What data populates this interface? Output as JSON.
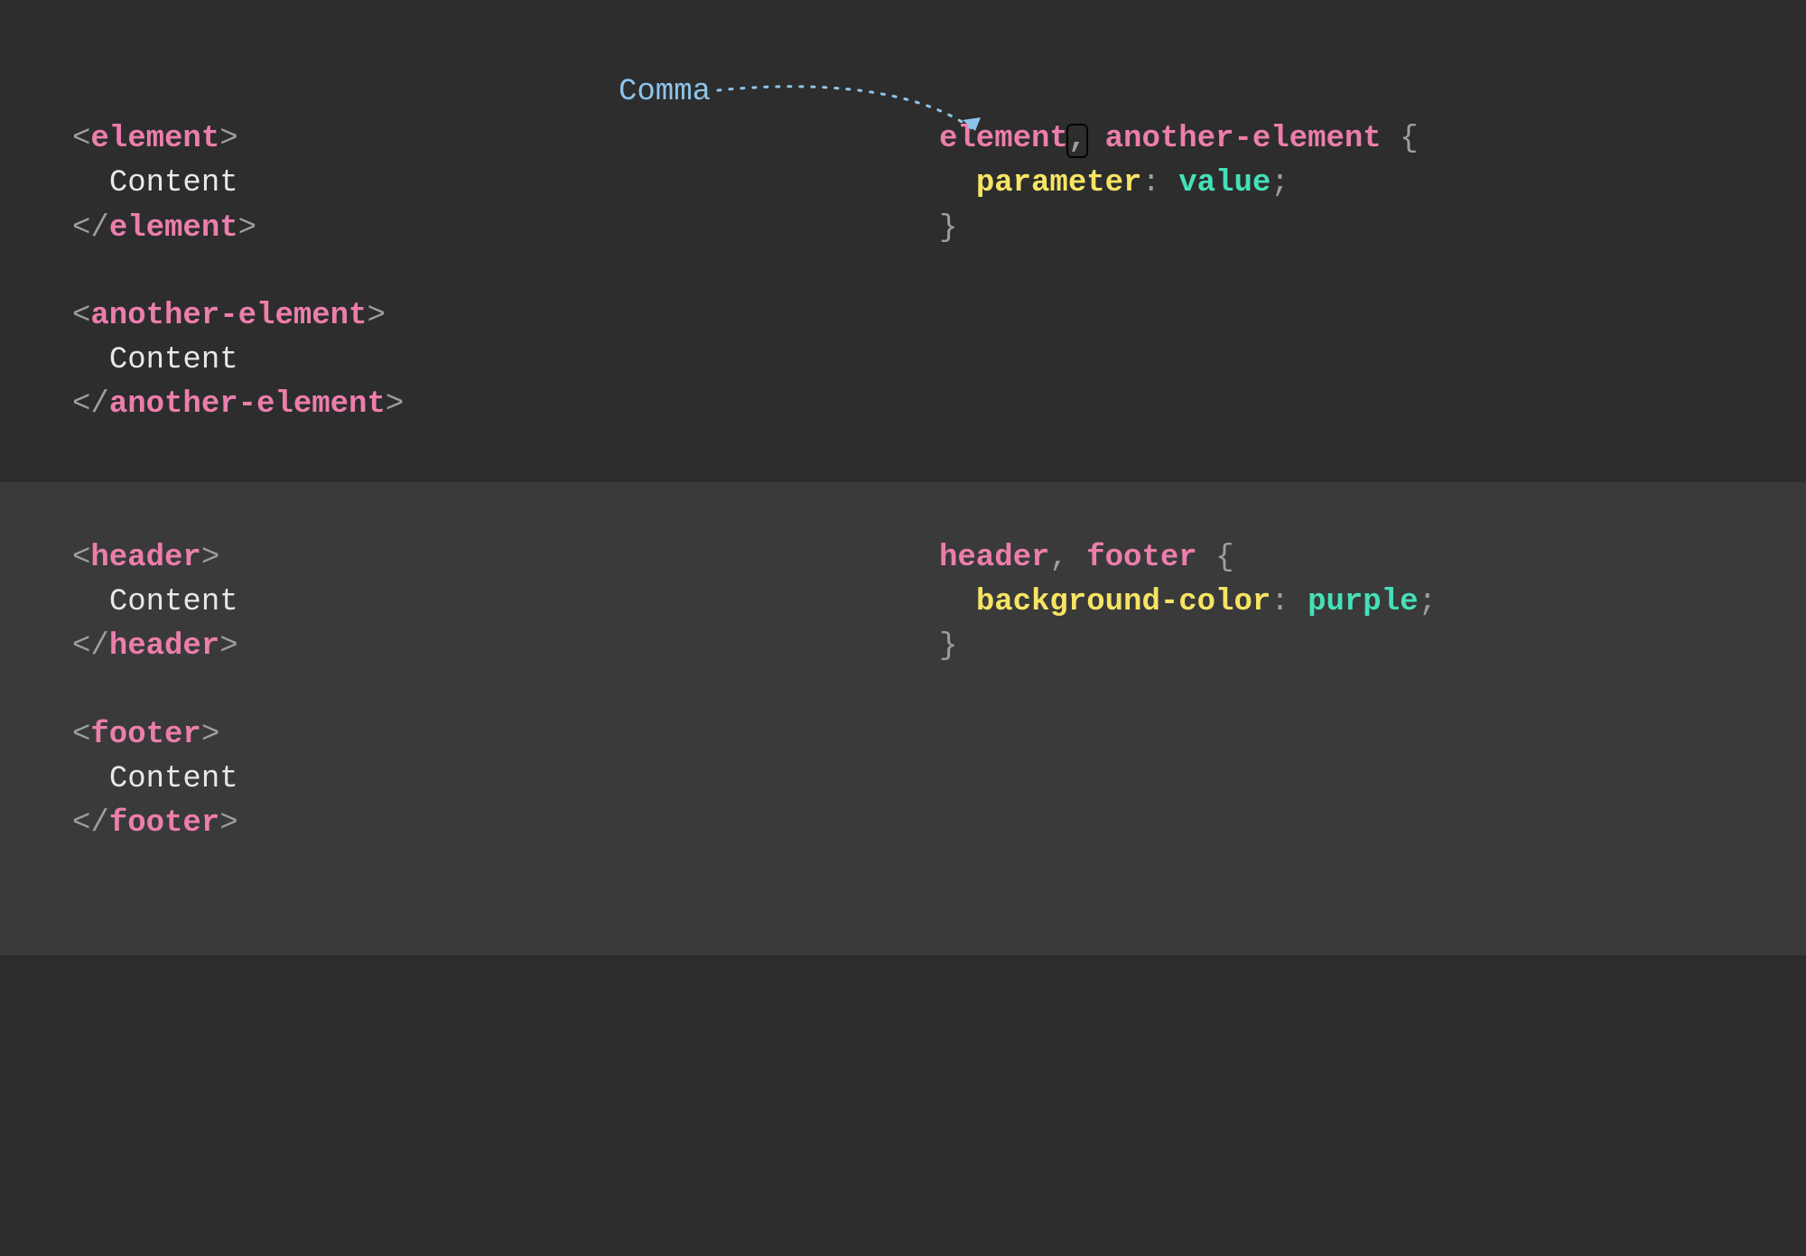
{
  "annotation": {
    "label": "Comma"
  },
  "top": {
    "html": {
      "block1": {
        "tag": "element",
        "content": "Content"
      },
      "block2": {
        "tag": "another-element",
        "content": "Content"
      }
    },
    "css": {
      "sel1": "element",
      "sep": ",",
      "sel2": "another-element",
      "open": "{",
      "prop": "parameter",
      "colon": ":",
      "val": "value",
      "semi": ";",
      "close": "}"
    }
  },
  "bottom": {
    "html": {
      "block1": {
        "tag": "header",
        "content": "Content"
      },
      "block2": {
        "tag": "footer",
        "content": "Content"
      }
    },
    "css": {
      "sel1": "header",
      "sep": ",",
      "sel2": "footer",
      "open": "{",
      "prop": "background-color",
      "colon": ":",
      "val": "purple",
      "semi": ";",
      "close": "}"
    }
  },
  "glyph": {
    "lt": "<",
    "gt": ">",
    "slash": "/"
  }
}
